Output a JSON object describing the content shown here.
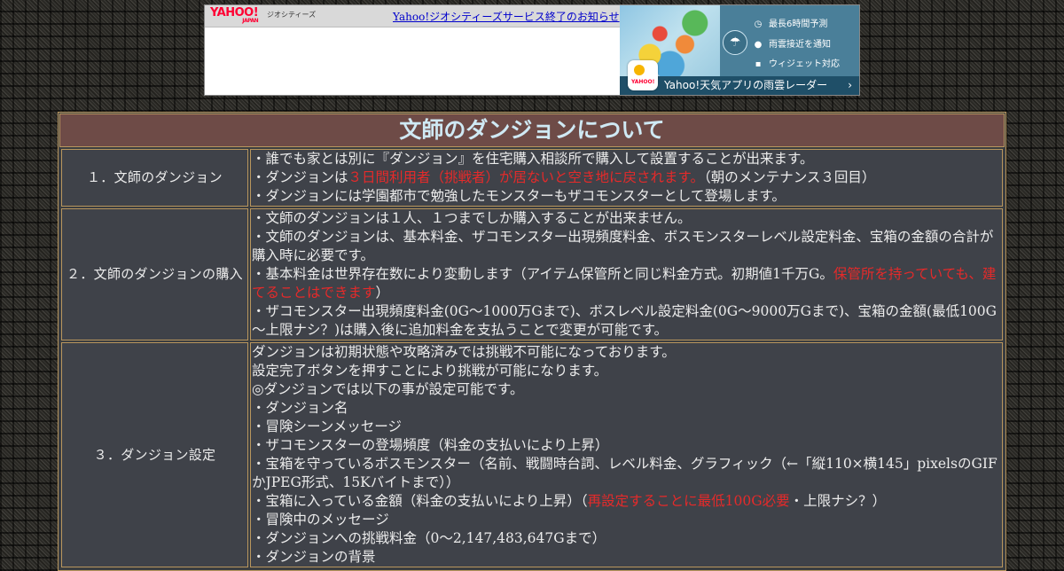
{
  "banner": {
    "logo_text": "YAHOO!",
    "logo_sub": "JAPAN",
    "service_name": "ジオシティーズ",
    "notice_link": "Yahoo!ジオシティーズサービス終了のお知らせ"
  },
  "ad": {
    "features": [
      "最長6時間予測",
      "雨雲接近を通知",
      "ウィジェット対応"
    ],
    "feature_icons": [
      "clock-icon",
      "location-pin-icon",
      "widget-grid-icon"
    ],
    "bar_text": "Yahoo!天気アプリの雨雲レーダー",
    "app_logo_text": "YAHOO!",
    "chevron": "›"
  },
  "page": {
    "title": "文師のダンジョンについて",
    "colors": {
      "title_bg": "#6e4b47",
      "title_text": "#cfe9f4",
      "cell_bg": "#3f4249",
      "border": "#b8965e",
      "red": "#e52a2a"
    }
  },
  "sections": [
    {
      "head": "１．文師のダンジョン",
      "lines": [
        {
          "t": "・誰でも家とは別に『ダンジョン』を住宅購入相談所で購入して設置することが出来ます。"
        },
        {
          "a": "・ダンジョンは",
          "r": "３日間利用者（挑戦者）が居ないと空き地に戻されます。",
          "b": "（朝のメンテナンス３回目）"
        },
        {
          "t": "・ダンジョンには学園都市で勉強したモンスターもザコモンスターとして登場します。"
        }
      ]
    },
    {
      "head": "２．文師のダンジョンの購入",
      "lines": [
        {
          "t": "・文師のダンジョンは１人、１つまでしか購入することが出来ません。"
        },
        {
          "t": "・文師のダンジョンは、基本料金、ザコモンスター出現頻度料金、ボスモンスターレベル設定料金、宝箱の金額の合計が購入時に必要です。"
        },
        {
          "a": "・基本料金は世界存在数により変動します（アイテム保管所と同じ料金方式。初期値1千万G。",
          "r": "保管所を持っていても、建てることはできます",
          "b": "）"
        },
        {
          "t": "・ザコモンスター出現頻度料金(0G～1000万Gまで)、ボスレベル設定料金(0G～9000万Gまで)、宝箱の金額(最低100G～上限ナシ？)は購入後に追加料金を支払うことで変更が可能です。"
        }
      ]
    },
    {
      "head": "３．ダンジョン設定",
      "lines": [
        {
          "t": "ダンジョンは初期状態や攻略済みでは挑戦不可能になっております。"
        },
        {
          "t": "設定完了ボタンを押すことにより挑戦が可能になります。"
        },
        {
          "t": "◎ダンジョンでは以下の事が設定可能です。"
        },
        {
          "t": "・ダンジョン名"
        },
        {
          "t": "・冒険シーンメッセージ"
        },
        {
          "t": "・ザコモンスターの登場頻度（料金の支払いにより上昇）"
        },
        {
          "t": "・宝箱を守っているボスモンスター（名前、戦闘時台詞、レベル料金、グラフィック（←「縦110×横145」pixelsのGIFかJPEG形式、15Kバイトまで））"
        },
        {
          "a": "・宝箱に入っている金額（料金の支払いにより上昇）（",
          "r": "再設定することに最低100G必要",
          "b": "・上限ナシ？）"
        },
        {
          "t": "・冒険中のメッセージ"
        },
        {
          "t": "・ダンジョンへの挑戦料金（0～2,147,483,647Gまで）"
        },
        {
          "t": "・ダンジョンの背景"
        }
      ]
    }
  ]
}
